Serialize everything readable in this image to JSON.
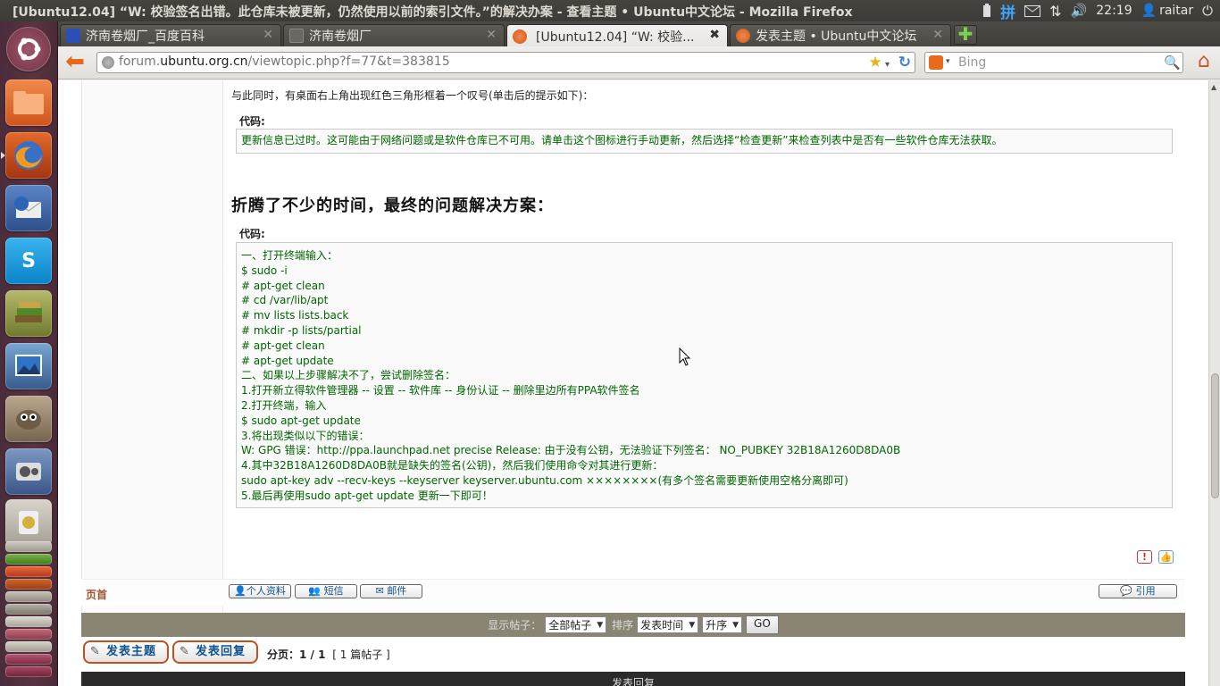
{
  "window": {
    "title": "[Ubuntu12.04] “W: 校验签名出错。此仓库未被更新，仍然使用以前的索引文件。”的解决办案 - 查看主题 • Ubuntu中文论坛 - Mozilla Firefox"
  },
  "panel": {
    "input_method": "拼",
    "time": "22:19",
    "user": "raitar"
  },
  "tabs": [
    {
      "label": "济南卷烟厂_百度百科"
    },
    {
      "label": "济南卷烟厂"
    },
    {
      "label": "[Ubuntu12.04] “W: 校验..."
    },
    {
      "label": "发表主题 • Ubuntu中文论坛"
    }
  ],
  "nav": {
    "url_prefix": "forum.",
    "url_domain": "ubuntu.org.cn",
    "url_path": "/viewtopic.php?f=77&t=383815",
    "search_placeholder": "Bing"
  },
  "post": {
    "intro_text": "与此同时，有桌面右上角出现红色三角形框着一个叹号(单击后的提示如下)：",
    "code_label_1": "代码:",
    "code_1": "更新信息已过时。这可能由于网络问题或是软件仓库已不可用。请单击这个图标进行手动更新，然后选择“检查更新”来检查列表中是否有一些软件仓库无法获取。",
    "heading": "折腾了不少的时间，最终的问题解决方案：",
    "code_label_2": "代码:",
    "code_2_lines": [
      "一、打开终端输入：",
      "$ sudo -i",
      "# apt-get clean",
      "# cd /var/lib/apt",
      "# mv lists lists.back",
      "# mkdir -p lists/partial",
      "# apt-get clean",
      "# apt-get update",
      "二、如果以上步骤解决不了，尝试删除签名：",
      "1.打开新立得软件管理器 -- 设置 -- 软件库 -- 身份认证 -- 删除里边所有PPA软件签名",
      "2.打开终端，输入",
      "$ sudo apt-get update",
      "3.将出现类似以下的错误：",
      "W: GPG 错误：http://ppa.launchpad.net precise Release: 由于没有公钥，无法验证下列签名： NO_PUBKEY 32B18A1260D8DA0B",
      "4.其中32B18A1260D8DA0B就是缺失的签名(公钥)，然后我们使用命令对其进行更新：",
      "sudo apt-key adv --recv-keys --keyserver keyserver.ubuntu.com ××××××××(有多个签名需要更新使用空格分离即可)",
      "5.最后再使用sudo apt-get update 更新一下即可！"
    ]
  },
  "profile_row": {
    "top_link": "页首",
    "profile": "个人资料",
    "pm": "短信",
    "email": "邮件",
    "quote": "引用"
  },
  "sortbar": {
    "display_label": "显示帖子：",
    "display_value": "全部帖子",
    "sort_label": "排序",
    "sort_value": "发表时间",
    "order_value": "升序",
    "go": "GO"
  },
  "actions": {
    "new_topic": "发表主题",
    "reply": "发表回复",
    "pagination_label": "分页：",
    "pagination_value": "1 / 1",
    "post_count": "[ 1 篇帖子 ]"
  },
  "reply_header": "发表回复",
  "colors": {
    "launcher": "#5a3441",
    "code_text": "#006600",
    "link": "#105289",
    "sortbar": "#8a8573"
  }
}
